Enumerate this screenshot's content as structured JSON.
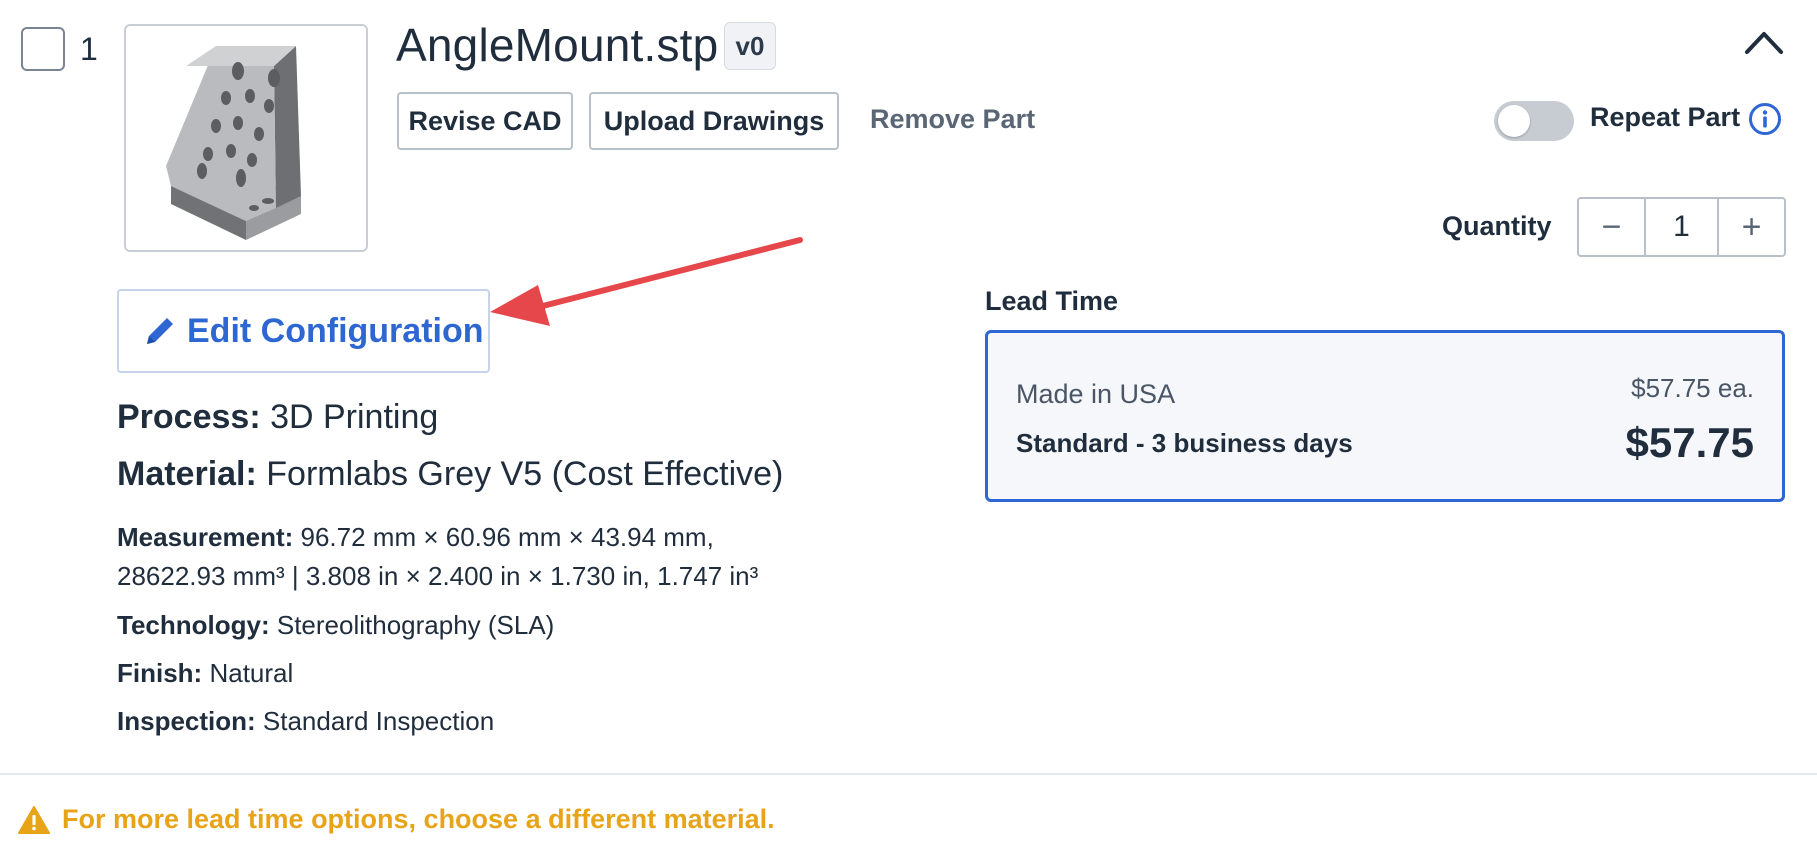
{
  "part": {
    "index": "1",
    "filename": "AngleMount.stp",
    "version": "v0",
    "revise_label": "Revise CAD",
    "upload_label": "Upload Drawings",
    "remove_label": "Remove Part",
    "repeat_label": "Repeat Part",
    "repeat_on": false,
    "quantity_label": "Quantity",
    "quantity": "1",
    "minus_glyph": "−",
    "plus_glyph": "+"
  },
  "config": {
    "edit_label": "Edit Configuration",
    "process_key": "Process:",
    "process_val": "3D Printing",
    "material_key": "Material:",
    "material_val": "Formlabs Grey V5 (Cost Effective)",
    "measure_key": "Measurement:",
    "measure_val": "96.72 mm × 60.96 mm × 43.94 mm, 28622.93 mm³ | 3.808 in × 2.400 in × 1.730 in, 1.747 in³",
    "tech_key": "Technology:",
    "tech_val": "Stereolithography (SLA)",
    "finish_key": "Finish:",
    "finish_val": "Natural",
    "inspect_key": "Inspection:",
    "inspect_val": "Standard Inspection"
  },
  "lead_time": {
    "label": "Lead Time",
    "origin": "Made in USA",
    "option": "Standard - 3 business days",
    "unit_price": "$57.75 ea.",
    "total": "$57.75"
  },
  "warning": {
    "text": "For more lead time options, choose a different material."
  },
  "colors": {
    "accent": "#2e67d2",
    "warning": "#e8a418",
    "annotation_arrow": "#e5474b"
  },
  "icons": [
    "chevron-up-icon",
    "info-icon",
    "pencil-icon",
    "warning-icon",
    "minus-icon",
    "plus-icon"
  ]
}
